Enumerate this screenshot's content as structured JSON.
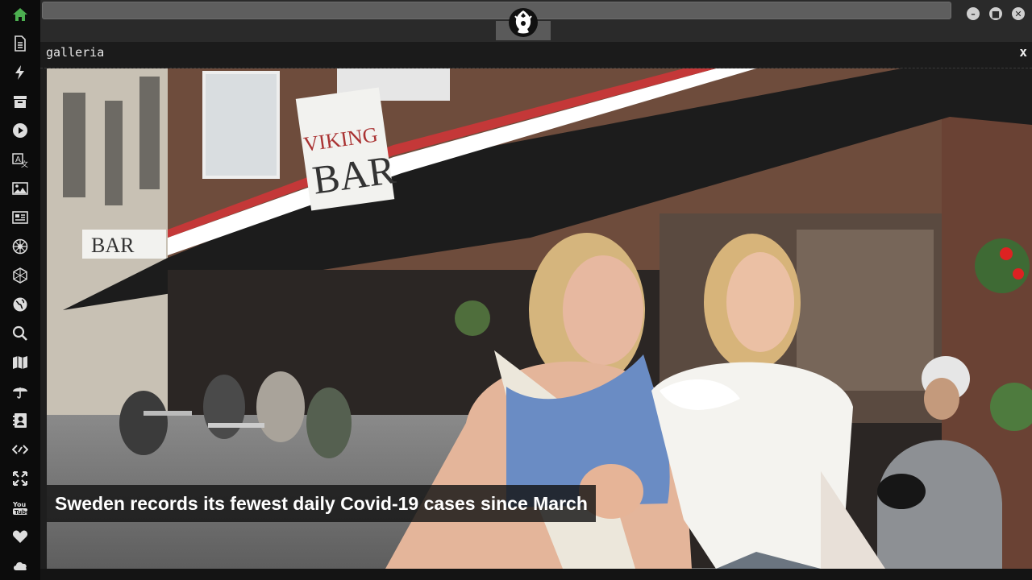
{
  "sidebar": {
    "items": [
      {
        "icon": "home-icon",
        "active": true
      },
      {
        "icon": "document-icon"
      },
      {
        "icon": "lightning-icon"
      },
      {
        "icon": "archive-icon"
      },
      {
        "icon": "play-icon"
      },
      {
        "icon": "translate-icon"
      },
      {
        "icon": "image-icon"
      },
      {
        "icon": "newspaper-icon"
      },
      {
        "icon": "rebel-alliance-icon"
      },
      {
        "icon": "hexagon-network-icon"
      },
      {
        "icon": "globe-icon"
      },
      {
        "icon": "search-icon"
      },
      {
        "icon": "map-icon"
      },
      {
        "icon": "umbrella-icon"
      },
      {
        "icon": "contact-card-icon"
      },
      {
        "icon": "code-icon"
      },
      {
        "icon": "expand-icon"
      },
      {
        "icon": "youtube-icon"
      },
      {
        "icon": "heart-icon"
      },
      {
        "icon": "cloud-icon"
      }
    ],
    "active_color": "#4caf50"
  },
  "topbar": {
    "logo": "galactic-empire-icon",
    "window_controls": [
      "minimize",
      "maximize",
      "close"
    ]
  },
  "panel": {
    "title": "galleria",
    "close_label": "x"
  },
  "gallery": {
    "image_description": "viking-bar-street-photo",
    "sign_text": "VIKING BAR",
    "sign_text_2": "BAR",
    "caption": "Sweden records its fewest daily Covid-19 cases since March"
  }
}
